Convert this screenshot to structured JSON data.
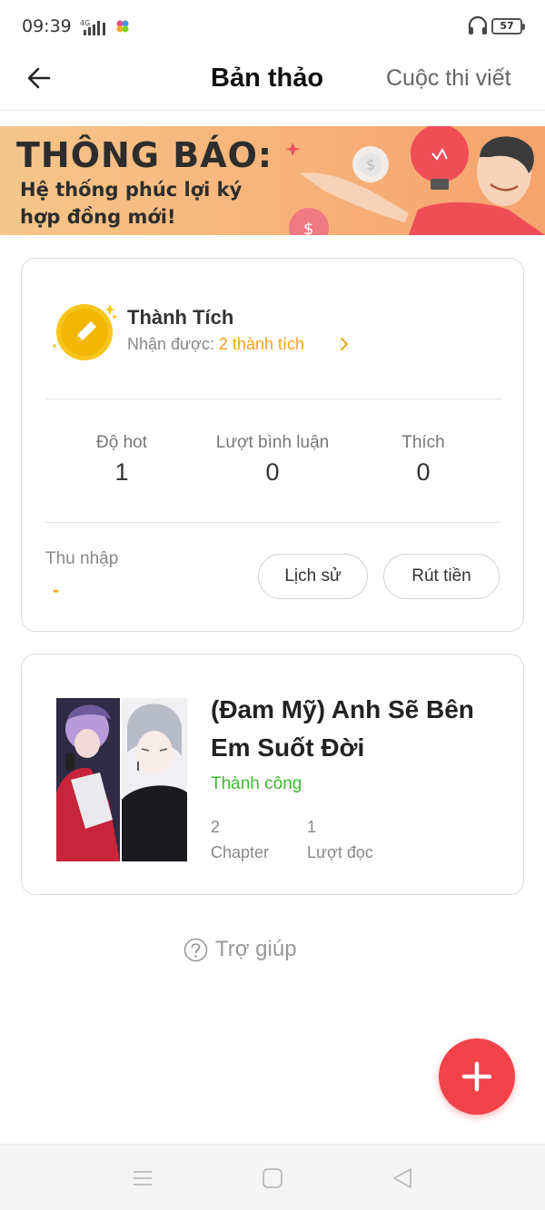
{
  "status_bar": {
    "time": "09:39",
    "network": "4G",
    "battery": "57"
  },
  "header": {
    "title": "Bản thảo",
    "link": "Cuộc thi viết"
  },
  "banner": {
    "title": "THÔNG BÁO:",
    "line1": "Hệ thống phúc lợi ký",
    "line2": "hợp đồng mới!",
    "colors": {
      "from": "#f5c78a",
      "to": "#f6a36d"
    }
  },
  "achievement": {
    "title": "Thành Tích",
    "received_label": "Nhận được:",
    "received_value": "2 thành tích"
  },
  "stats": [
    {
      "label": "Độ hot",
      "value": "1"
    },
    {
      "label": "Lượt bình luận",
      "value": "0"
    },
    {
      "label": "Thích",
      "value": "0"
    }
  ],
  "income": {
    "label": "Thu nhập",
    "value": "-",
    "history_button": "Lịch sử",
    "withdraw_button": "Rút tiền"
  },
  "book": {
    "title": "(Đam Mỹ) Anh Sẽ Bên Em Suốt Đời",
    "status": "Thành công",
    "chapters": {
      "value": "2",
      "label": "Chapter"
    },
    "reads": {
      "value": "1",
      "label": "Lượt đọc"
    }
  },
  "help": {
    "label": "Trợ giúp"
  },
  "icons": {
    "back": "arrow-left-icon",
    "medal": "pencil-medal-icon",
    "chevron": "chevron-right-icon",
    "help": "question-circle-icon",
    "fab": "plus-icon",
    "nav": [
      "menu-icon",
      "home-square-icon",
      "back-triangle-icon"
    ]
  },
  "colors": {
    "accent": "#f0a31d",
    "success": "#3dbb2f",
    "fab": "#f2424a"
  }
}
